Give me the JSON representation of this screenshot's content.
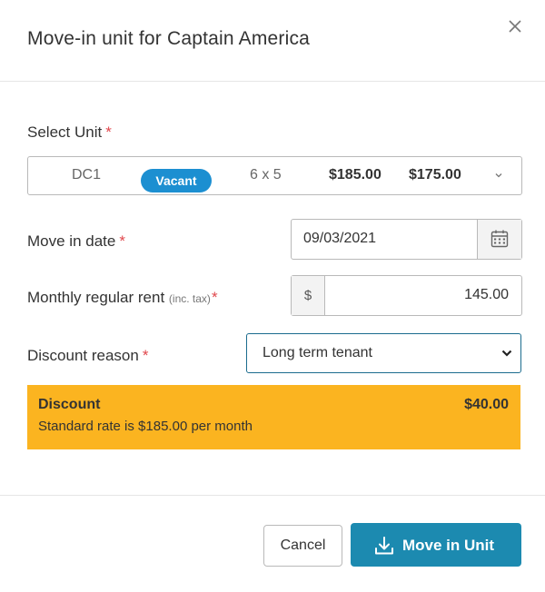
{
  "dialog": {
    "title": "Move-in unit for Captain America",
    "close_icon": "close-icon"
  },
  "unit": {
    "label": "Select Unit",
    "required": "*",
    "code": "DC1",
    "status": "Vacant",
    "size": "6 x 5",
    "price_standard": "$185.00",
    "price_offer": "$175.00",
    "dropdown_icon": "chevron-down-icon"
  },
  "move_in": {
    "label": "Move in date",
    "required": "*",
    "value": "09/03/2021",
    "icon": "calendar-icon"
  },
  "rent": {
    "label": "Monthly regular rent",
    "label_note": "(inc. tax)",
    "required": "*",
    "prefix": "$",
    "value": "145.00"
  },
  "discount": {
    "label": "Discount reason",
    "required": "*",
    "selected": "Long term tenant",
    "dropdown_icon": "chevron-down-icon"
  },
  "banner": {
    "title": "Discount",
    "amount": "$40.00",
    "subtitle": "Standard rate is $185.00 per month",
    "color": "#fbb420"
  },
  "footer": {
    "cancel_label": "Cancel",
    "primary_label": "Move in Unit",
    "primary_icon": "download-icon",
    "primary_color": "#1c8ab0"
  }
}
